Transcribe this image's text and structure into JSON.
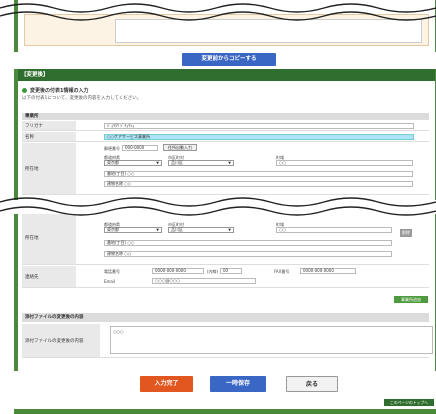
{
  "copy_button": "変更前からコピーする",
  "after_section": {
    "header": "【変更後】",
    "title": "変更後の付表1情報の入力",
    "description": "以下の付表1について、変更後の内容を入力してください。",
    "office_header": "事業所",
    "fields": {
      "furigana_label": "フリガナ",
      "furigana_value": "ｼﾞｮｳﾎｳ ｼﾞｷｮｳｼｮ",
      "name_label": "名称",
      "name_value": "○○ケアサービス事業所",
      "address_label": "所在地",
      "zip_label": "郵便番号",
      "zip_value": "000-0000",
      "search_button": "住所自動入力",
      "pref_label": "都道府県",
      "pref_value": "東京都",
      "city_label": "市区町村",
      "city_value": "品川区",
      "town_label": "町域",
      "town_value": "○○",
      "chome_label": "番地(丁目)",
      "chome_value": "○○",
      "building_label": "建物名称",
      "building_value": "○○",
      "contact_label": "連絡先",
      "tel_label": "電話番号",
      "tel_value": "0000-000-0000",
      "ext_label": "(内線)",
      "ext_value": "00",
      "fax_label": "FAX番号",
      "fax_value": "0000-000-0000",
      "email_label": "Email",
      "email_value": "○○○@○○○",
      "delete_button": "削除",
      "add_office_button": "事業所追加"
    },
    "attachment_header": "添付ファイルの変更後の内容",
    "attachment_label": "添付ファイルの変更後の内容",
    "attachment_value": "○○○"
  },
  "footer_buttons": {
    "done": "入力完了",
    "temp_save": "一時保存",
    "back": "戻る",
    "page_top": "このページのトップへ"
  }
}
